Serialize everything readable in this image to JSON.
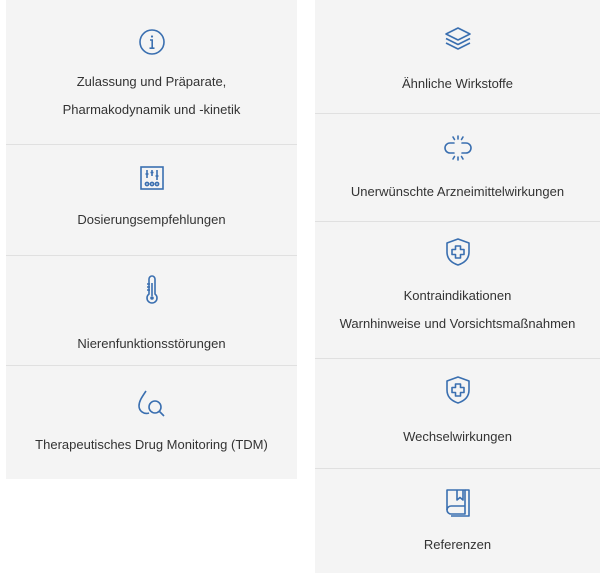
{
  "colors": {
    "accent": "#3a6fb0",
    "background": "#f4f4f4",
    "divider": "#e0e0e0",
    "text": "#333333"
  },
  "left_tiles": [
    {
      "icon": "info-circle-icon",
      "lines": [
        "Zulassung und Präparate,",
        "Pharmakodynamik und -kinetik"
      ]
    },
    {
      "icon": "sliders-icon",
      "lines": [
        "Dosierungsempfehlungen"
      ]
    },
    {
      "icon": "thermometer-icon",
      "lines": [
        "Nierenfunktionsstörungen"
      ]
    },
    {
      "icon": "drop-search-icon",
      "lines": [
        "Therapeutisches Drug Monitoring (TDM)"
      ]
    }
  ],
  "right_tiles": [
    {
      "icon": "layers-icon",
      "lines": [
        "Ähnliche Wirkstoffe"
      ]
    },
    {
      "icon": "broken-link-icon",
      "lines": [
        "Unerwünschte Arzneimittelwirkungen"
      ]
    },
    {
      "icon": "shield-plus-icon",
      "lines": [
        "Kontraindikationen",
        "Warnhinweise und Vorsichtsmaßnahmen"
      ]
    },
    {
      "icon": "shield-plus-icon",
      "lines": [
        "Wechselwirkungen"
      ]
    },
    {
      "icon": "book-bookmark-icon",
      "lines": [
        "Referenzen"
      ]
    }
  ]
}
